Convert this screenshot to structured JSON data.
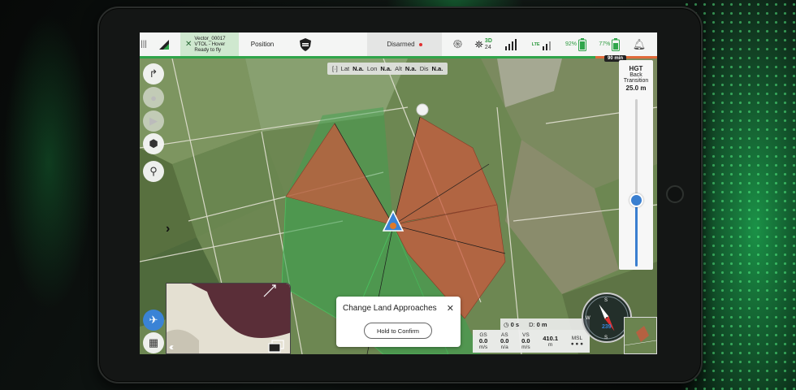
{
  "topbar": {
    "vehicle_name": "Vector_00017",
    "vehicle_mode": "VTOL - Hover",
    "vehicle_status": "Ready to fly",
    "flight_mode": "Position",
    "arm_status": "Disarmed",
    "gps_fix": "3D",
    "satellites": "24",
    "lte_label": "LTE",
    "battery_1": "92%",
    "battery_2": "77%",
    "flight_time_remaining": "90 min",
    "mission_progress_fraction": 0.88
  },
  "coords": {
    "lat_label": "Lat",
    "lat_value": "N.a.",
    "lon_label": "Lon",
    "lon_value": "N.a.",
    "alt_label": "Alt",
    "alt_value": "N.a.",
    "dis_label": "Dis",
    "dis_value": "N.a."
  },
  "altitude_panel": {
    "title": "HGT",
    "line1": "Back",
    "line2": "Transition",
    "value": "25.0 m",
    "slider_fraction": 0.4
  },
  "dialog": {
    "title": "Change Land Approaches",
    "close": "✕",
    "button": "Hold to Confirm"
  },
  "telemetry": {
    "time_label": "0 s",
    "distance_label": "D:",
    "distance_value": "0 m",
    "gs_label": "GS",
    "gs_value": "0.0",
    "gs_unit": "m/s",
    "as_label": "AS",
    "as_value": "0.0",
    "as_unit": "n/a",
    "vs_label": "VS",
    "vs_value": "0.0",
    "vs_unit": "m/s",
    "alt_value": "410.1",
    "alt_unit": "m",
    "msl_label": "MSL",
    "heading": "239"
  },
  "compass": {
    "n": "S",
    "s": "S",
    "w": "W"
  },
  "colors": {
    "accent_green": "#2fa54a",
    "approach_red": "#c8593d",
    "approach_green": "#3aa24e",
    "primary_blue": "#3a83d6"
  }
}
